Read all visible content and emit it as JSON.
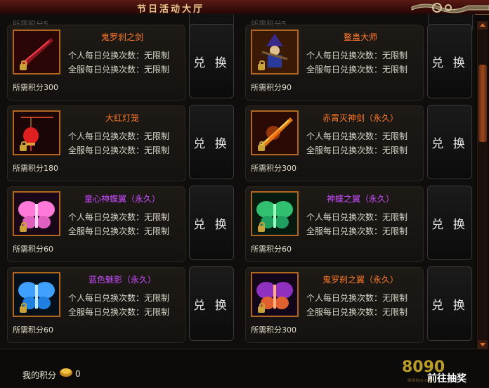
{
  "window": {
    "title": "节日活动大厅"
  },
  "top_partial": {
    "left": "所需积分5",
    "right": "所需积分5"
  },
  "items": [
    {
      "name": "鬼罗刹之剑",
      "name_color": "orange",
      "personal": "个人每日兑换次数：无限制",
      "server": "全服每日兑换次数：无限制",
      "cost": "所需积分300",
      "button": "兑 换",
      "icon": "dark-sword-icon"
    },
    {
      "name": "鳌蛊大师",
      "name_color": "orange",
      "personal": "个人每日兑换次数：无限制",
      "server": "全服每日兑换次数：无限制",
      "cost": "所需积分90",
      "button": "兑 换",
      "icon": "wizard-doll-icon"
    },
    {
      "name": "大红灯笼",
      "name_color": "orange",
      "personal": "个人每日兑换次数：无限制",
      "server": "全服每日兑换次数：无限制",
      "cost": "所需积分180",
      "button": "兑 换",
      "icon": "red-lantern-icon"
    },
    {
      "name": "赤霄灭神剑（永久）",
      "name_color": "orange",
      "personal": "个人每日兑换次数：无限制",
      "server": "全服每日兑换次数：无限制",
      "cost": "所需积分300",
      "button": "兑 换",
      "icon": "fire-sword-icon"
    },
    {
      "name": "童心神蝶翼（永久）",
      "name_color": "purple",
      "personal": "个人每日兑换次数：无限制",
      "server": "全服每日兑换次数：无限制",
      "cost": "所需积分60",
      "button": "兑 换",
      "icon": "pink-wings-icon"
    },
    {
      "name": "神蝶之翼（永久）",
      "name_color": "purple",
      "personal": "个人每日兑换次数：无限制",
      "server": "全服每日兑换次数：无限制",
      "cost": "所需积分60",
      "button": "兑 换",
      "icon": "green-wings-icon"
    },
    {
      "name": "蓝色魅影（永久）",
      "name_color": "purple",
      "personal": "个人每日兑换次数：无限制",
      "server": "全服每日兑换次数：无限制",
      "cost": "所需积分60",
      "button": "兑 换",
      "icon": "blue-wings-icon"
    },
    {
      "name": "鬼罗刹之翼（永久）",
      "name_color": "orange",
      "personal": "个人每日兑换次数：无限制",
      "server": "全服每日兑换次数：无限制",
      "cost": "所需积分300",
      "button": "兑 换",
      "icon": "purple-wings-icon"
    }
  ],
  "footer": {
    "my_score_label": "我的积分",
    "my_score_value": "0",
    "watermark": "8090",
    "watermark_text": "前往抽奖",
    "watermark_url": "8090yx.com"
  },
  "colors": {
    "orange": "#ff7a2a",
    "purple": "#c94cff",
    "accent": "#b0661e"
  }
}
